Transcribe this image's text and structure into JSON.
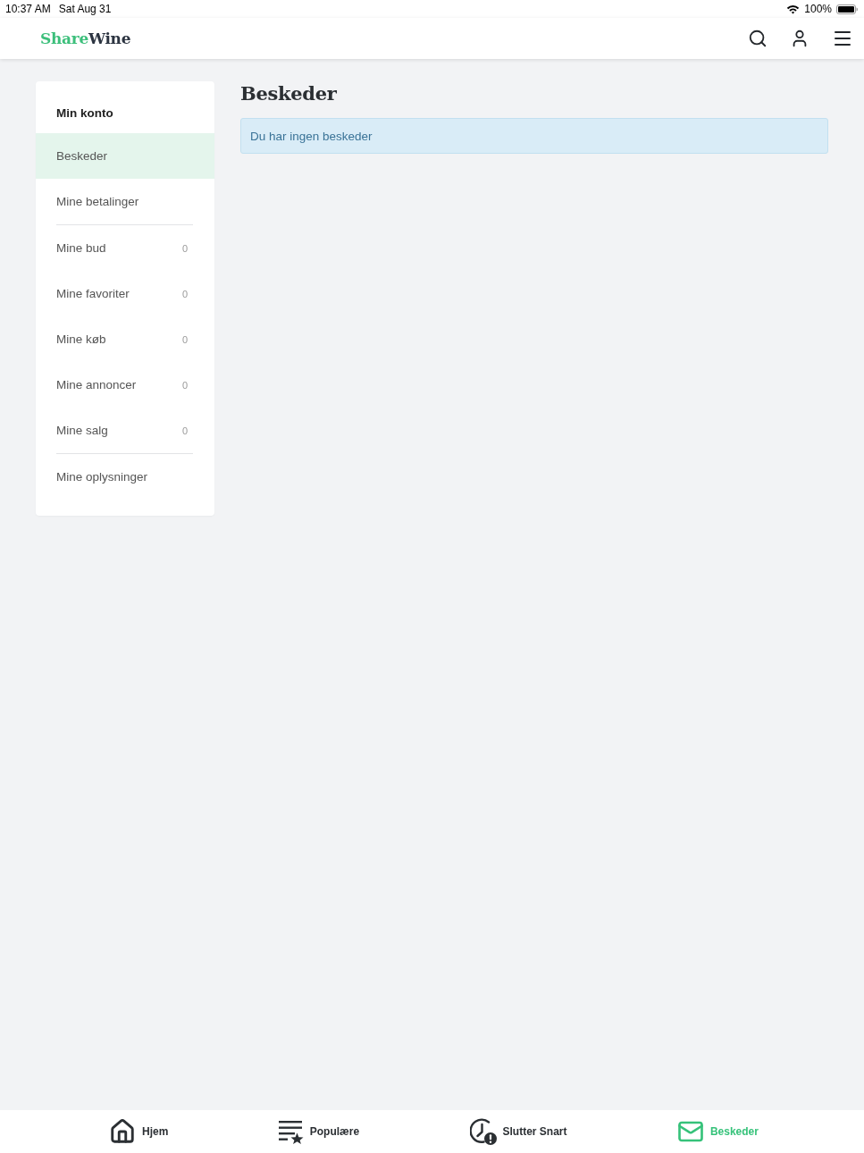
{
  "status_bar": {
    "time": "10:37 AM",
    "date": "Sat Aug 31",
    "battery_text": "100%"
  },
  "header": {
    "logo": {
      "accent": "Share",
      "rest": "Wine"
    }
  },
  "sidebar": {
    "title": "Min konto",
    "sections": [
      {
        "items": [
          {
            "label": "Beskeder",
            "selected": true
          },
          {
            "label": "Mine betalinger",
            "selected": false
          }
        ]
      },
      {
        "items": [
          {
            "label": "Mine bud",
            "count": "0",
            "selected": false
          },
          {
            "label": "Mine favoriter",
            "count": "0",
            "selected": false
          },
          {
            "label": "Mine køb",
            "count": "0",
            "selected": false
          },
          {
            "label": "Mine annoncer",
            "count": "0",
            "selected": false
          },
          {
            "label": "Mine salg",
            "count": "0",
            "selected": false
          }
        ]
      },
      {
        "items": [
          {
            "label": "Mine oplysninger",
            "selected": false
          }
        ]
      }
    ]
  },
  "main": {
    "title": "Beskeder",
    "alert": "Du har ingen beskeder"
  },
  "bottom_nav": [
    {
      "label": "Hjem",
      "selected": false
    },
    {
      "label": "Populære",
      "selected": false
    },
    {
      "label": "Slutter Snart",
      "selected": false
    },
    {
      "label": "Beskeder",
      "selected": true
    }
  ]
}
